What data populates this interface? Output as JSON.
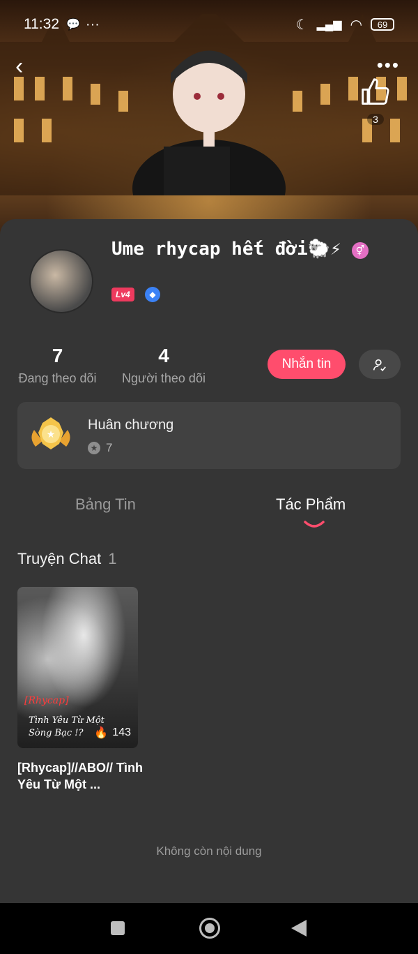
{
  "status_bar": {
    "time": "11:32",
    "battery": "69"
  },
  "header": {
    "like_count": "3"
  },
  "profile": {
    "username": "Ume rhycap hết đời🐑⚡",
    "level_badge": "Lv4",
    "following_count": "7",
    "following_label": "Đang theo dõi",
    "followers_count": "4",
    "followers_label": "Người theo dõi",
    "message_button": "Nhắn tin"
  },
  "medal": {
    "title": "Huân chương",
    "count": "7"
  },
  "tabs": {
    "news": "Bảng Tin",
    "works": "Tác Phẩm"
  },
  "section": {
    "title": "Truyện Chat",
    "count": "1"
  },
  "story": {
    "cover_tag": "[Rhycap]",
    "cover_text": "Tình Yêu Từ Một Sòng Bạc !?",
    "views": "143",
    "title": "[Rhycap]//ABO// Tình Yêu Từ Một ..."
  },
  "end_text": "Không còn nội dung",
  "colors": {
    "accent": "#ff4d6d",
    "card_bg": "#353535"
  }
}
